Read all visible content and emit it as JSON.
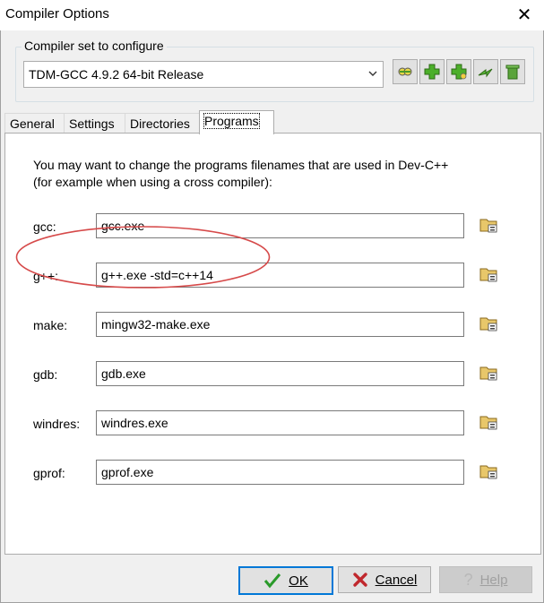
{
  "window": {
    "title": "Compiler Options",
    "close_icon": "✕"
  },
  "compiler_set": {
    "group_label": "Compiler set to configure",
    "selected": "TDM-GCC 4.9.2 64-bit Release",
    "toolbar_icons": [
      "properties-icon",
      "add-icon",
      "add-folder-icon",
      "rename-icon",
      "delete-icon"
    ]
  },
  "tabs": [
    {
      "label": "General",
      "active": false
    },
    {
      "label": "Settings",
      "active": false
    },
    {
      "label": "Directories",
      "active": false
    },
    {
      "label": "Programs",
      "active": true
    }
  ],
  "programs": {
    "intro_line1": "You may want to change the programs filenames that are used in Dev-C++",
    "intro_line2": "(for example when using a cross compiler):",
    "rows": [
      {
        "label": "gcc:",
        "value": "gcc.exe"
      },
      {
        "label": "g++:",
        "value": "g++.exe -std=c++14"
      },
      {
        "label": "make:",
        "value": "mingw32-make.exe"
      },
      {
        "label": "gdb:",
        "value": "gdb.exe"
      },
      {
        "label": "windres:",
        "value": "windres.exe"
      },
      {
        "label": "gprof:",
        "value": "gprof.exe"
      }
    ]
  },
  "buttons": {
    "ok_label": "OK",
    "cancel_label": "Cancel",
    "help_label": "Help"
  },
  "annotation": {
    "highlight_color": "#d64a4a"
  }
}
